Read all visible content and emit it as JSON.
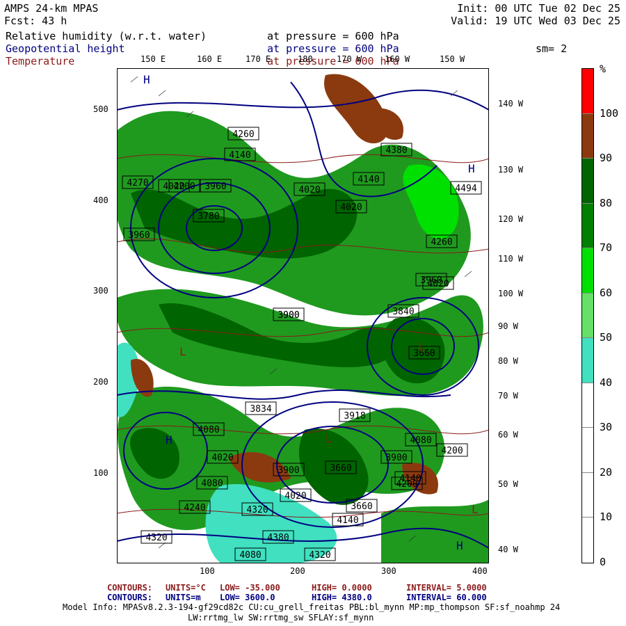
{
  "header": {
    "model": "AMPS 24-km MPAS",
    "fcst": "Fcst:   43 h",
    "init": "Init: 00 UTC Tue 02 Dec 25",
    "valid": "Valid: 19 UTC Wed 03 Dec 25",
    "fields": [
      {
        "name": "Relative humidity (w.r.t. water)",
        "level": "at pressure =  600 hPa"
      },
      {
        "name": "Geopotential height",
        "level": "at pressure =  600 hPa"
      },
      {
        "name": "Temperature",
        "level": "at pressure = 600 hPa"
      }
    ],
    "smoothing": "sm= 2"
  },
  "map": {
    "lon_top": [
      "150 E",
      "160 E",
      "170 E",
      "180",
      "170 W",
      "160 W",
      "150 W"
    ],
    "lon_right": [
      "140 W",
      "130 W",
      "120 W",
      "110 W",
      "100 W",
      "90 W",
      "80 W",
      "70 W",
      "60 W",
      "50 W",
      "40 W"
    ],
    "y_ticks": [
      "500",
      "400",
      "300",
      "200",
      "100"
    ],
    "x_ticks": [
      "100",
      "200",
      "300",
      "400"
    ],
    "height_labels": [
      "3960",
      "4260",
      "4140",
      "4200",
      "4270",
      "4020",
      "3960",
      "4020",
      "4140",
      "4020",
      "3900",
      "3900",
      "4380",
      "4494",
      "4260",
      "3840",
      "3960",
      "4020",
      "3660",
      "3780",
      "3834",
      "3918",
      "4080",
      "3900",
      "4020",
      "3660",
      "4140",
      "4320",
      "4380",
      "4200",
      "4320",
      "4140",
      "4200",
      "4080",
      "4020",
      "3660",
      "3900",
      "4080",
      "4240",
      "4320",
      "4080"
    ],
    "pressure_marks": [
      "H",
      "H",
      "L",
      "L",
      "H",
      "L",
      "L",
      "H"
    ]
  },
  "colorbar": {
    "unit": "%",
    "labels": [
      "100",
      "90",
      "80",
      "70",
      "60",
      "50",
      "40",
      "30",
      "20",
      "10",
      "0"
    ],
    "colors": [
      "#ff0000",
      "#8b3a0f",
      "#006400",
      "#007f00",
      "#00e000",
      "#66e066",
      "#40e0c0",
      "#ffffff",
      "#ffffff",
      "#ffffff",
      "#ffffff"
    ]
  },
  "footer": {
    "line1_label": "CONTOURS:",
    "line1_units": "UNITS=°C",
    "line1_low": "LOW=  -35.000",
    "line1_high": "HIGH=   0.0000",
    "line1_int": "INTERVAL=    5.0000",
    "line2_label": "CONTOURS:",
    "line2_units": "UNITS=m",
    "line2_low": "LOW=  3600.0",
    "line2_high": "HIGH=  4380.0",
    "line2_int": "INTERVAL=   60.000",
    "model_info": "Model Info: MPASv8.2.3-194-gf29cd82c CU:cu_grell_freitas PBL:bl_mynn MP:mp_thompson SF:sf_noahmp 24",
    "model_info2": "LW:rrtmg_lw SW:rrtmg_sw SFLAY:sf_mynn"
  },
  "colors": {
    "rh_dark": "#006400",
    "rh_mid": "#1f9a1f",
    "rh_light": "#00e000",
    "rh_cyan": "#40e0c0",
    "rh_brown": "#8b3a0f",
    "height_line": "#000080",
    "temp_line": "#8b1a1a"
  }
}
